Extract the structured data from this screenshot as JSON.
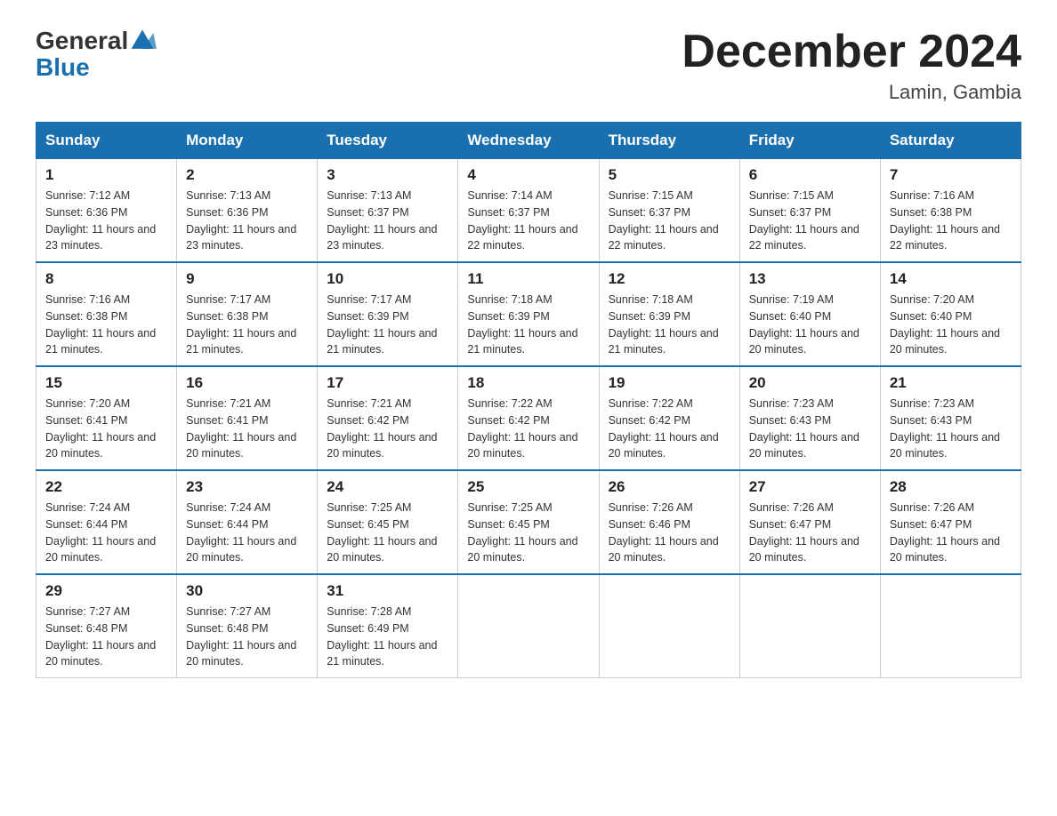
{
  "header": {
    "logo_line1": "General",
    "logo_line2": "Blue",
    "month_title": "December 2024",
    "location": "Lamin, Gambia"
  },
  "days_of_week": [
    "Sunday",
    "Monday",
    "Tuesday",
    "Wednesday",
    "Thursday",
    "Friday",
    "Saturday"
  ],
  "weeks": [
    [
      {
        "day": "1",
        "sunrise": "7:12 AM",
        "sunset": "6:36 PM",
        "daylight": "11 hours and 23 minutes."
      },
      {
        "day": "2",
        "sunrise": "7:13 AM",
        "sunset": "6:36 PM",
        "daylight": "11 hours and 23 minutes."
      },
      {
        "day": "3",
        "sunrise": "7:13 AM",
        "sunset": "6:37 PM",
        "daylight": "11 hours and 23 minutes."
      },
      {
        "day": "4",
        "sunrise": "7:14 AM",
        "sunset": "6:37 PM",
        "daylight": "11 hours and 22 minutes."
      },
      {
        "day": "5",
        "sunrise": "7:15 AM",
        "sunset": "6:37 PM",
        "daylight": "11 hours and 22 minutes."
      },
      {
        "day": "6",
        "sunrise": "7:15 AM",
        "sunset": "6:37 PM",
        "daylight": "11 hours and 22 minutes."
      },
      {
        "day": "7",
        "sunrise": "7:16 AM",
        "sunset": "6:38 PM",
        "daylight": "11 hours and 22 minutes."
      }
    ],
    [
      {
        "day": "8",
        "sunrise": "7:16 AM",
        "sunset": "6:38 PM",
        "daylight": "11 hours and 21 minutes."
      },
      {
        "day": "9",
        "sunrise": "7:17 AM",
        "sunset": "6:38 PM",
        "daylight": "11 hours and 21 minutes."
      },
      {
        "day": "10",
        "sunrise": "7:17 AM",
        "sunset": "6:39 PM",
        "daylight": "11 hours and 21 minutes."
      },
      {
        "day": "11",
        "sunrise": "7:18 AM",
        "sunset": "6:39 PM",
        "daylight": "11 hours and 21 minutes."
      },
      {
        "day": "12",
        "sunrise": "7:18 AM",
        "sunset": "6:39 PM",
        "daylight": "11 hours and 21 minutes."
      },
      {
        "day": "13",
        "sunrise": "7:19 AM",
        "sunset": "6:40 PM",
        "daylight": "11 hours and 20 minutes."
      },
      {
        "day": "14",
        "sunrise": "7:20 AM",
        "sunset": "6:40 PM",
        "daylight": "11 hours and 20 minutes."
      }
    ],
    [
      {
        "day": "15",
        "sunrise": "7:20 AM",
        "sunset": "6:41 PM",
        "daylight": "11 hours and 20 minutes."
      },
      {
        "day": "16",
        "sunrise": "7:21 AM",
        "sunset": "6:41 PM",
        "daylight": "11 hours and 20 minutes."
      },
      {
        "day": "17",
        "sunrise": "7:21 AM",
        "sunset": "6:42 PM",
        "daylight": "11 hours and 20 minutes."
      },
      {
        "day": "18",
        "sunrise": "7:22 AM",
        "sunset": "6:42 PM",
        "daylight": "11 hours and 20 minutes."
      },
      {
        "day": "19",
        "sunrise": "7:22 AM",
        "sunset": "6:42 PM",
        "daylight": "11 hours and 20 minutes."
      },
      {
        "day": "20",
        "sunrise": "7:23 AM",
        "sunset": "6:43 PM",
        "daylight": "11 hours and 20 minutes."
      },
      {
        "day": "21",
        "sunrise": "7:23 AM",
        "sunset": "6:43 PM",
        "daylight": "11 hours and 20 minutes."
      }
    ],
    [
      {
        "day": "22",
        "sunrise": "7:24 AM",
        "sunset": "6:44 PM",
        "daylight": "11 hours and 20 minutes."
      },
      {
        "day": "23",
        "sunrise": "7:24 AM",
        "sunset": "6:44 PM",
        "daylight": "11 hours and 20 minutes."
      },
      {
        "day": "24",
        "sunrise": "7:25 AM",
        "sunset": "6:45 PM",
        "daylight": "11 hours and 20 minutes."
      },
      {
        "day": "25",
        "sunrise": "7:25 AM",
        "sunset": "6:45 PM",
        "daylight": "11 hours and 20 minutes."
      },
      {
        "day": "26",
        "sunrise": "7:26 AM",
        "sunset": "6:46 PM",
        "daylight": "11 hours and 20 minutes."
      },
      {
        "day": "27",
        "sunrise": "7:26 AM",
        "sunset": "6:47 PM",
        "daylight": "11 hours and 20 minutes."
      },
      {
        "day": "28",
        "sunrise": "7:26 AM",
        "sunset": "6:47 PM",
        "daylight": "11 hours and 20 minutes."
      }
    ],
    [
      {
        "day": "29",
        "sunrise": "7:27 AM",
        "sunset": "6:48 PM",
        "daylight": "11 hours and 20 minutes."
      },
      {
        "day": "30",
        "sunrise": "7:27 AM",
        "sunset": "6:48 PM",
        "daylight": "11 hours and 20 minutes."
      },
      {
        "day": "31",
        "sunrise": "7:28 AM",
        "sunset": "6:49 PM",
        "daylight": "11 hours and 21 minutes."
      },
      null,
      null,
      null,
      null
    ]
  ]
}
